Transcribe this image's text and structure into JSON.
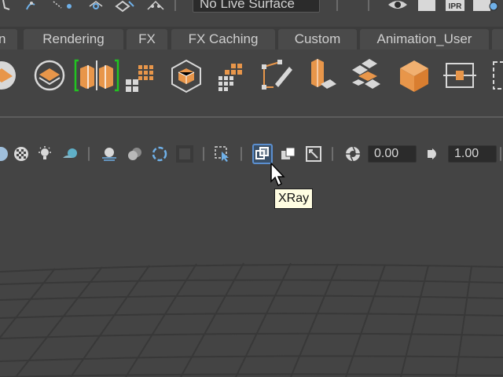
{
  "status_bar": {
    "live_surface_value": "No Live Surface",
    "render_label": "IPR"
  },
  "shelf_tabs": [
    {
      "label": "n"
    },
    {
      "label": "Rendering"
    },
    {
      "label": "FX"
    },
    {
      "label": "FX Caching"
    },
    {
      "label": "Custom"
    },
    {
      "label": "Animation_User"
    },
    {
      "label": ""
    }
  ],
  "panel_toolbar": {
    "exposure_value": "0.00",
    "gamma_value": "1.00"
  },
  "tooltip": {
    "text": "XRay"
  },
  "colors": {
    "accent_orange": "#e8964a",
    "selection_green": "#21c421",
    "highlight_blue": "#5b8fd0",
    "background": "#444444"
  }
}
